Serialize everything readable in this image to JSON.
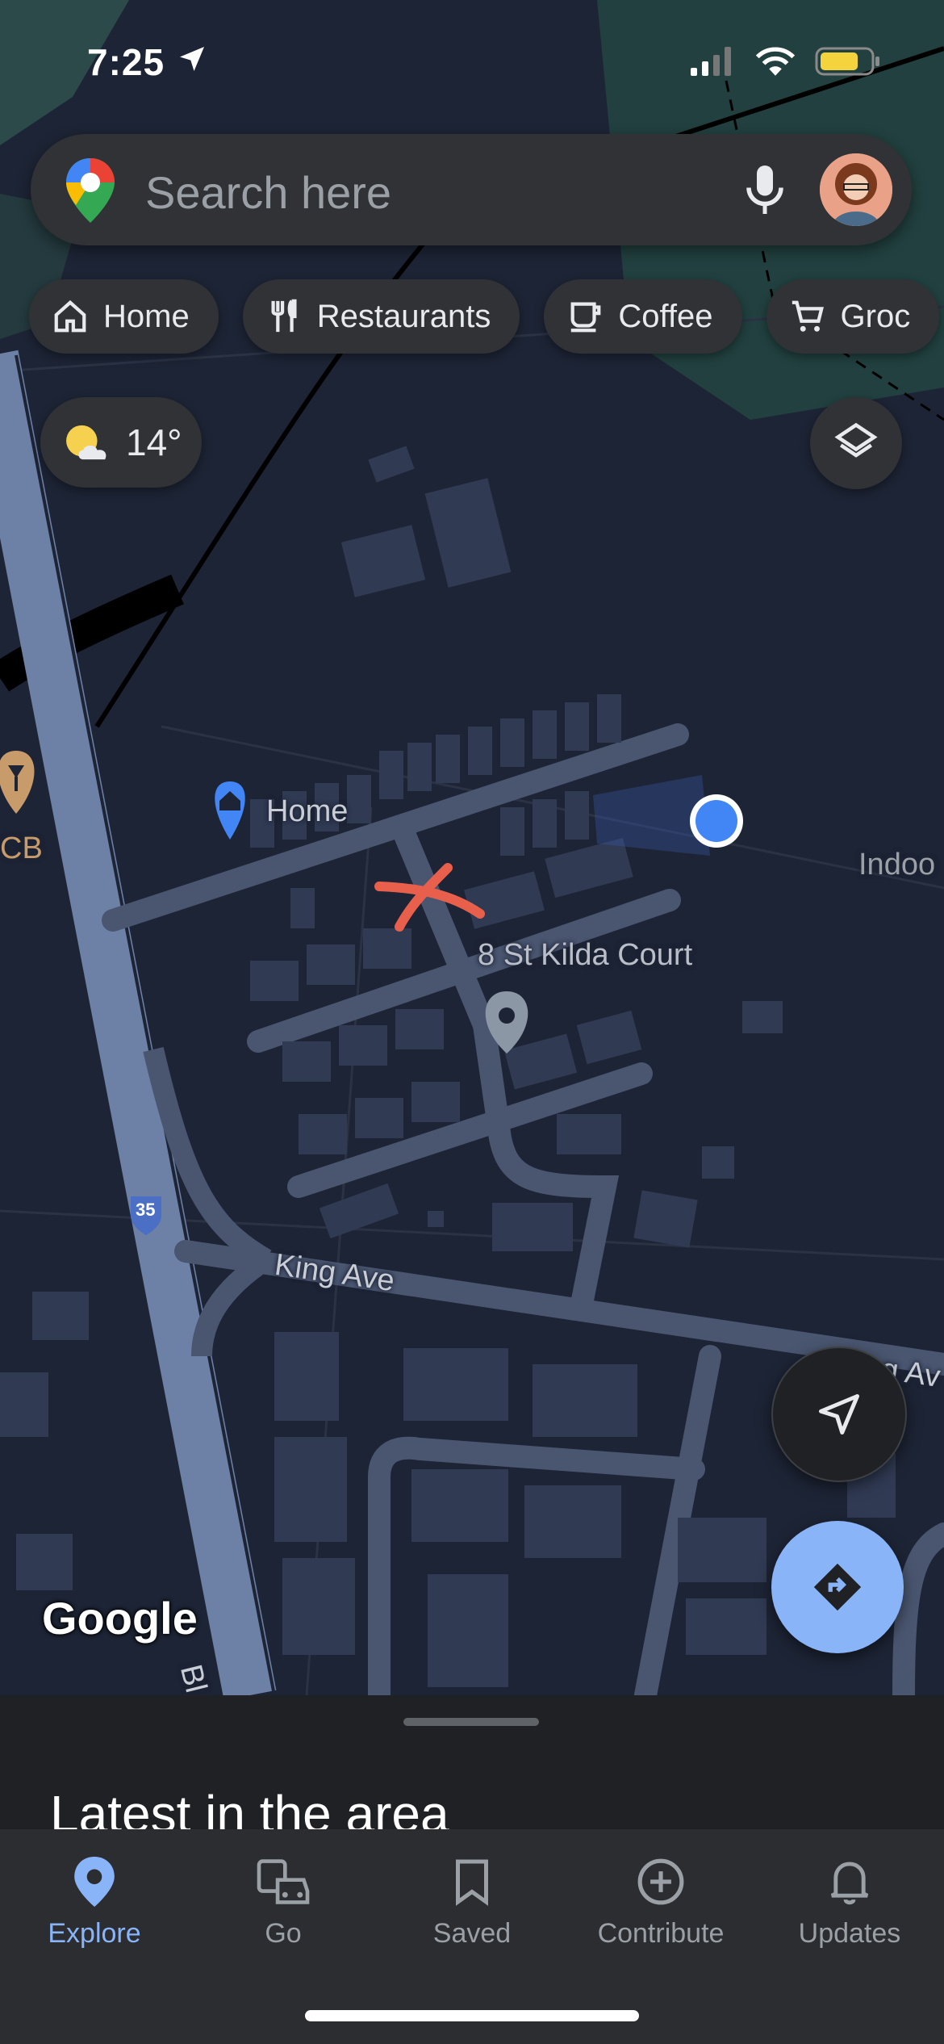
{
  "status_bar": {
    "time": "7:25"
  },
  "search": {
    "placeholder": "Search here"
  },
  "chips": [
    {
      "label": "Home",
      "icon": "home-icon"
    },
    {
      "label": "Restaurants",
      "icon": "fork-knife-icon"
    },
    {
      "label": "Coffee",
      "icon": "coffee-cup-icon"
    },
    {
      "label": "Groc",
      "icon": "cart-icon"
    }
  ],
  "weather": {
    "temperature": "14°",
    "icon": "partly-cloudy-icon"
  },
  "map": {
    "pins": {
      "home_label": "Home",
      "address_label": "8 St Kilda Court",
      "indoor_label": "Indoo",
      "cb_label": "CB"
    },
    "roads": {
      "king_ave": "King Ave",
      "king_ave_right": "g Av",
      "highway_shield": "35",
      "bottom_road": "Bl"
    },
    "attribution": "Google"
  },
  "bottom_sheet": {
    "title": "Latest in the area"
  },
  "nav": {
    "explore": "Explore",
    "go": "Go",
    "saved": "Saved",
    "contribute": "Contribute",
    "updates": "Updates"
  },
  "colors": {
    "accent": "#8ab4f8",
    "map_bg": "#1d2435",
    "road": "#4a5670",
    "highway": "#6d80a6",
    "location_dot": "#4285f4",
    "annotation": "#e8604c"
  }
}
